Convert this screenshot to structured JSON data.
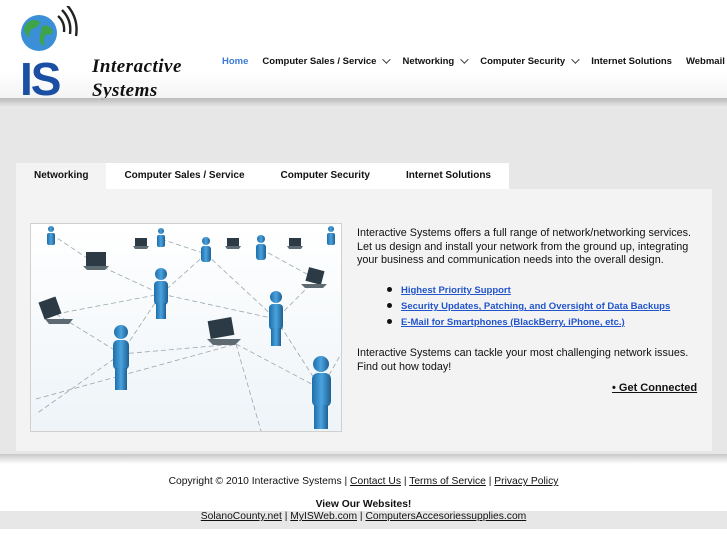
{
  "logo": {
    "mark": "IS",
    "line1": "Interactive",
    "line2": "Systems",
    "icon": "globe-signal-icon",
    "colors": {
      "mark": "#1a4fa3",
      "globe_ocean": "#3a8fd6",
      "globe_land": "#3fa34a"
    }
  },
  "nav": {
    "items": [
      {
        "label": "Home",
        "active": true,
        "dropdown": false
      },
      {
        "label": "Computer Sales / Service",
        "dropdown": true
      },
      {
        "label": "Networking",
        "dropdown": true
      },
      {
        "label": "Computer Security",
        "dropdown": true
      },
      {
        "label": "Internet Solutions",
        "dropdown": false
      },
      {
        "label": "Webmail",
        "dropdown": false
      }
    ],
    "active_color": "#3a7bd5"
  },
  "tabs": [
    {
      "label": "Networking",
      "active": true
    },
    {
      "label": "Computer Sales / Service"
    },
    {
      "label": "Computer Security"
    },
    {
      "label": "Internet Solutions"
    }
  ],
  "content": {
    "image": "network-people-laptops-image",
    "intro": "Interactive Systems offers a full range of network/networking services. Let us design and install your network from the ground up, integrating your business and communication needs into the overall design.",
    "bullets": [
      "Highest Priority Support",
      "Security Updates, Patching, and Oversight of Data Backups",
      "E-Mail for Smartphones (BlackBerry, iPhone, etc.)"
    ],
    "outro": "Interactive Systems can tackle your most challenging network issues. Find out how today!",
    "cta": "• Get Connected",
    "link_color": "#2255cc"
  },
  "footer": {
    "copyright_prefix": "Copyright © 2010 Interactive Systems |",
    "links": [
      "Contact Us",
      "Terms of Service",
      "Privacy Policy"
    ],
    "view_sites": "View Our Websites!",
    "sites": [
      "SolanoCounty.net",
      "MyISWeb.com",
      "ComputersAccesoriessupplies.com"
    ]
  }
}
